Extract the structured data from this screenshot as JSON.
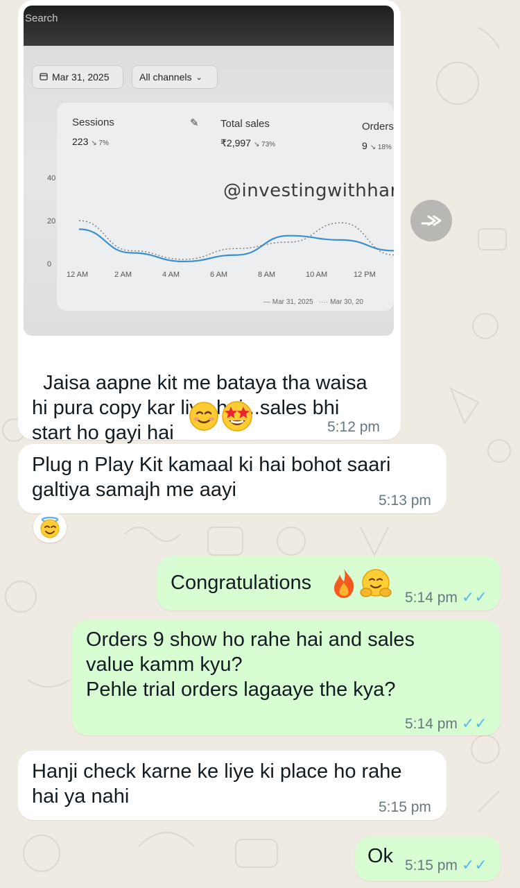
{
  "photo": {
    "search_label": "Search",
    "date_filter": "Mar 31, 2025",
    "channel_filter": "All channels",
    "metrics": [
      {
        "title": "Sessions",
        "value": "223",
        "change": "↘ 7%"
      },
      {
        "title": "Total sales",
        "value": "₹2,997",
        "change": "↘ 73%"
      },
      {
        "title": "Orders",
        "value": "9",
        "change": "↘ 18%"
      }
    ],
    "watermark": "@investingwithharsh"
  },
  "chart_data": {
    "type": "line",
    "x": [
      "12 AM",
      "2 AM",
      "4 AM",
      "6 AM",
      "8 AM",
      "10 AM",
      "12 PM"
    ],
    "yticks": [
      "40",
      "20",
      "0"
    ],
    "ylim": [
      0,
      40
    ],
    "legend_position": "bottom-right",
    "series": [
      {
        "name": "Mar 31, 2025",
        "style": "solid",
        "color": "#3a8fd0",
        "values": [
          16,
          5,
          1,
          4,
          13,
          11,
          6
        ]
      },
      {
        "name": "Mar 30, 20",
        "style": "dotted",
        "color": "#777777",
        "values": [
          20,
          6,
          2,
          7,
          10,
          19,
          4
        ]
      }
    ]
  },
  "messages": [
    {
      "type": "incoming",
      "text": "Jaisa aapne kit me bataya tha waisa\nhi pura copy kar liya hai...sales bhi\nstart ho gayi hai",
      "time": "5:12 pm"
    },
    {
      "type": "incoming",
      "text": "Plug n Play Kit kamaal ki hai bohot saari\ngaltiya samajh me aayi",
      "time": "5:13 pm"
    },
    {
      "type": "outgoing",
      "text": "Congratulations",
      "time": "5:14 pm"
    },
    {
      "type": "outgoing",
      "text": "Orders 9 show ho rahe hai and sales\nvalue kamm kyu?\nPehle trial orders lagaaye the kya?",
      "time": "5:14 pm"
    },
    {
      "type": "incoming",
      "text": "Hanji check karne ke liye ki place ho rahe\nhai ya nahi",
      "time": "5:15 pm"
    },
    {
      "type": "outgoing",
      "text": "Ok",
      "time": "5:15 pm"
    }
  ],
  "icons": {
    "forward": "forward-icon",
    "read_receipt": "double-check-icon",
    "reaction": "smiling-face-with-halo"
  }
}
